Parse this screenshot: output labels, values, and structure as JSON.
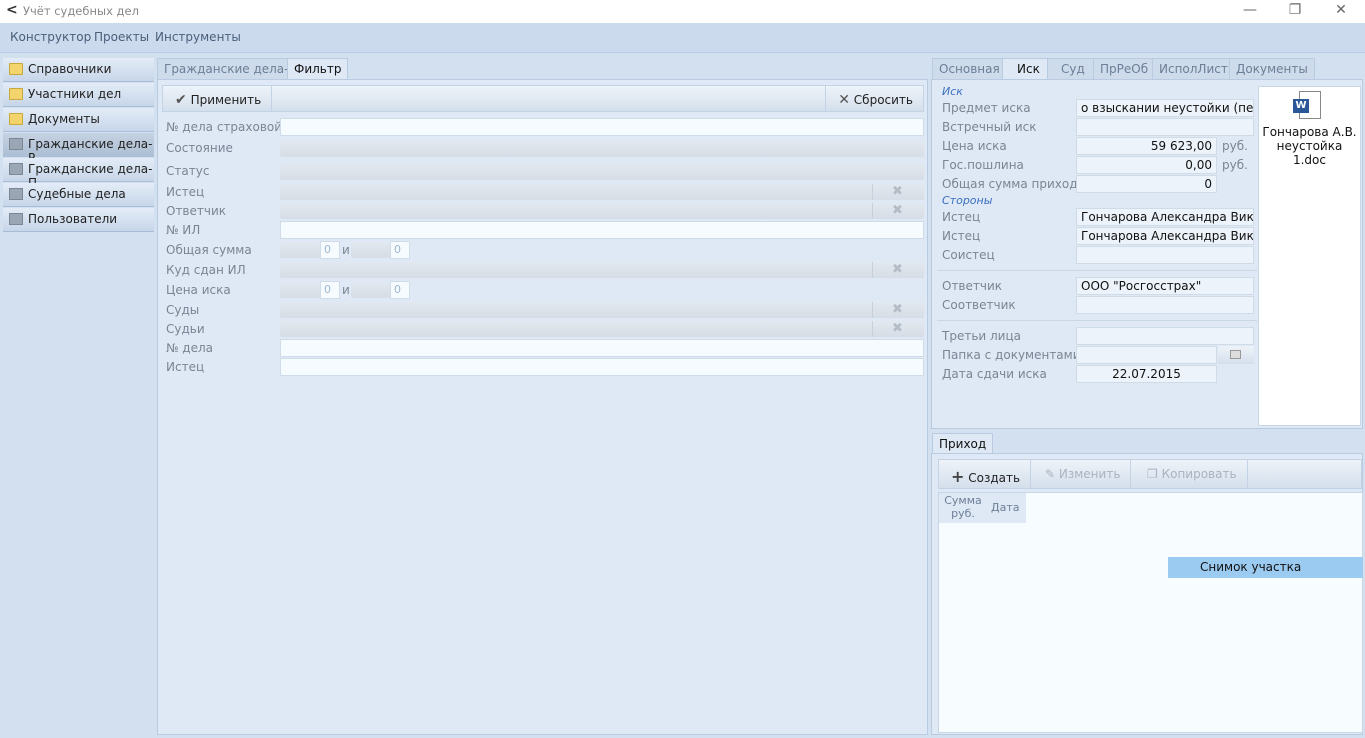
{
  "window": {
    "title": "Учёт судебных дел"
  },
  "menu": [
    "Конструктор",
    "Проекты",
    "Инструменты"
  ],
  "sidebar": {
    "items": [
      {
        "label": "Справочники",
        "icon": "folder-icon"
      },
      {
        "label": "Участники дел",
        "icon": "folder-icon"
      },
      {
        "label": "Документы",
        "icon": "folder-icon"
      },
      {
        "label": "Гражданские дела-Р",
        "icon": "table-icon",
        "selected": true
      },
      {
        "label": "Гражданские дела-П",
        "icon": "table-icon"
      },
      {
        "label": "Судебные дела",
        "icon": "table-icon"
      },
      {
        "label": "Пользователи",
        "icon": "table-icon"
      }
    ]
  },
  "main": {
    "tabs": [
      "Гражданские дела-Р",
      "Фильтр"
    ],
    "toolbar": {
      "apply": "Применить",
      "reset": "Сбросить"
    },
    "filter": {
      "labels": [
        "№ дела страховой",
        "Состояние",
        "Статус",
        "Истец",
        "Ответчик",
        "№ ИЛ",
        "Общая сумма",
        "Куд сдан ИЛ",
        "Цена иска",
        "Суды",
        "Судьи",
        "№ дела",
        "Истец"
      ],
      "range_sep": "и",
      "total_from": "0",
      "total_to": "0",
      "price_from": "0",
      "price_to": "0"
    }
  },
  "right": {
    "tabs": [
      "Основная",
      "Иск",
      "Суд",
      "ПрРеОб",
      "ИсполЛист",
      "Документы"
    ],
    "section_claim": "Иск",
    "section_parties": "Стороны",
    "fields": {
      "subject": {
        "label": "Предмет иска",
        "value": "о взыскании неустойки (пени)"
      },
      "counter": {
        "label": "Встречный иск",
        "value": ""
      },
      "price": {
        "label": "Цена иска",
        "value": "59 623,00",
        "unit": "руб."
      },
      "fee": {
        "label": "Гос.пошлина",
        "value": "0,00",
        "unit": "руб."
      },
      "income": {
        "label": "Общая сумма прихода",
        "value": "0"
      },
      "plaintiff1": {
        "label": "Истец",
        "value": "Гончарова Александра Викторовна"
      },
      "plaintiff2": {
        "label": "Истец",
        "value": "Гончарова Александра Викторовна"
      },
      "coplaintiff": {
        "label": "Соистец",
        "value": ""
      },
      "defendant": {
        "label": "Ответчик",
        "value": "ООО \"Росгосстрах\""
      },
      "codefendant": {
        "label": "Соответчик",
        "value": ""
      },
      "third": {
        "label": "Третьи лица",
        "value": ""
      },
      "folder": {
        "label": "Папка с документами",
        "value": ""
      },
      "date": {
        "label": "Дата сдачи иска",
        "value": "22.07.2015"
      }
    },
    "document": {
      "name": "Гончарова А.В. неустойка 1.doc"
    }
  },
  "income": {
    "tab": "Приход",
    "toolbar": {
      "create": "Создать",
      "edit": "Изменить",
      "copy": "Копировать"
    },
    "columns": [
      "Сумма руб.",
      "Дата"
    ]
  },
  "tooltip": "Снимок участка"
}
